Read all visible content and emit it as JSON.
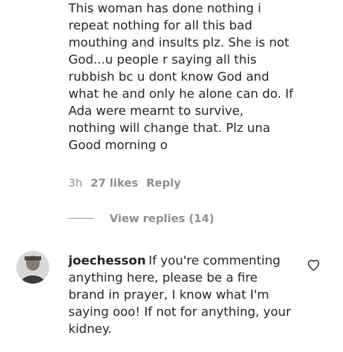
{
  "first_comment": {
    "text": "This woman has done nothing i repeat nothing for all this bad mouthing and insults plz. She is not God...u people r saying all this rubbish bc u dont know God and what he and only he alone can do. If Ada were mearnt to survive, nothing will change that. Plz una Good morning o",
    "time": "3h",
    "likes": "27 likes",
    "reply_label": "Reply",
    "view_replies_label": "View replies (14)"
  },
  "second_comment": {
    "username": "joechesson",
    "text": "If you're commenting anything here, please be a fire brand in prayer, I know what I'm saying ooo! If not for anything, your kidney.",
    "avatar_icon": "user-avatar-icon",
    "like_icon": "heart-outline-icon"
  }
}
